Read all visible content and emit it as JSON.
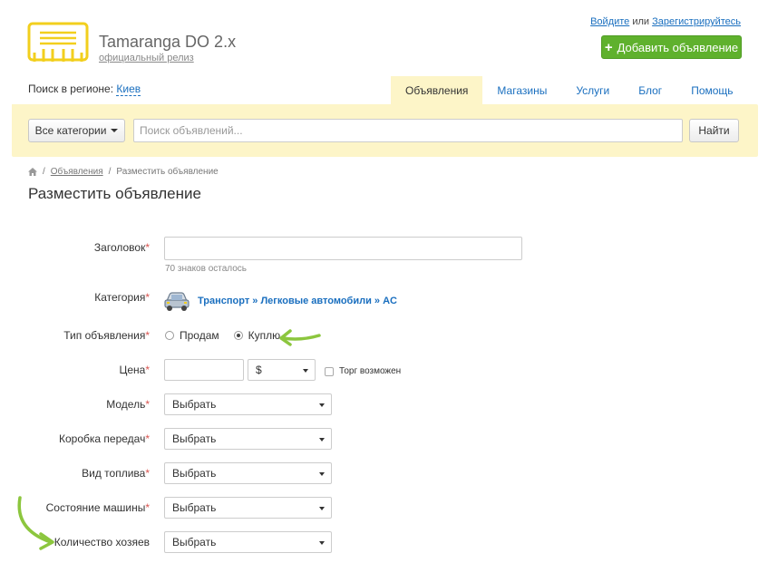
{
  "header": {
    "brand_title": "Tamaranga DO 2.x",
    "brand_sub": "официальный релиз",
    "login": "Войдите",
    "or": "или",
    "register": "Зарегистрируйтесь",
    "add_button": "Добавить объявление",
    "region_label": "Поиск в регионе:",
    "region_value": "Киев"
  },
  "nav": {
    "tabs": [
      {
        "label": "Объявления",
        "active": true
      },
      {
        "label": "Магазины"
      },
      {
        "label": "Услуги"
      },
      {
        "label": "Блог"
      },
      {
        "label": "Помощь"
      }
    ]
  },
  "search": {
    "category_button": "Все категории",
    "placeholder": "Поиск объявлений...",
    "find_button": "Найти"
  },
  "breadcrumb": {
    "link": "Объявления",
    "current": "Разместить объявление"
  },
  "page_title": "Разместить объявление",
  "form": {
    "title_label": "Заголовок",
    "title_hint": "70 знаков осталось",
    "category_label": "Категория",
    "category_value": "Транспорт » Легковые автомобили » AC",
    "type_label": "Тип объявления",
    "type_options": [
      "Продам",
      "Куплю"
    ],
    "type_selected": "Куплю",
    "price_label": "Цена",
    "currency": "$",
    "bargain_label": "Торг возможен",
    "model_label": "Модель",
    "gearbox_label": "Коробка передач",
    "fuel_label": "Вид топлива",
    "condition_label": "Состояние машины",
    "owners_label": "Количество хозяев",
    "select_placeholder": "Выбрать"
  },
  "colors": {
    "accent_green": "#5fb12d",
    "search_bg": "#fdf5c8",
    "link_blue": "#1a6fbf",
    "logo_yellow": "#f2cf1d",
    "arrow_green": "#8cc63e",
    "required_red": "#d9534f"
  },
  "icons": [
    "logo-icon",
    "plus-icon",
    "caret-down-icon",
    "home-icon",
    "car-icon",
    "radio-icon",
    "checkbox-icon",
    "arrow-annotation-icon"
  ]
}
